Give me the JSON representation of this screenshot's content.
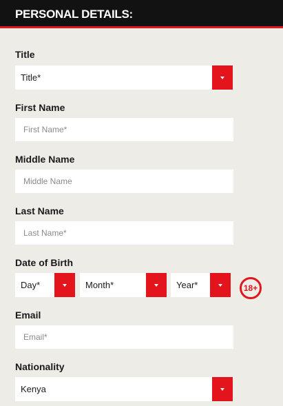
{
  "header": {
    "title": "PERSONAL DETAILS:"
  },
  "title_field": {
    "label": "Title",
    "value": "Title*"
  },
  "first_name": {
    "label": "First Name",
    "placeholder": "First Name*"
  },
  "middle_name": {
    "label": "Middle Name",
    "placeholder": "Middle Name"
  },
  "last_name": {
    "label": "Last Name",
    "placeholder": "Last Name*"
  },
  "dob": {
    "label": "Date of Birth",
    "day": "Day*",
    "month": "Month*",
    "year": "Year*",
    "age_badge": "18+"
  },
  "email": {
    "label": "Email",
    "placeholder": "Email*"
  },
  "nationality": {
    "label": "Nationality",
    "value": "Kenya"
  },
  "colors": {
    "accent": "#e3141b",
    "header_bg": "#121212",
    "page_bg": "#eeece7"
  },
  "icons": {
    "dropdown": "chevron-down-icon"
  }
}
